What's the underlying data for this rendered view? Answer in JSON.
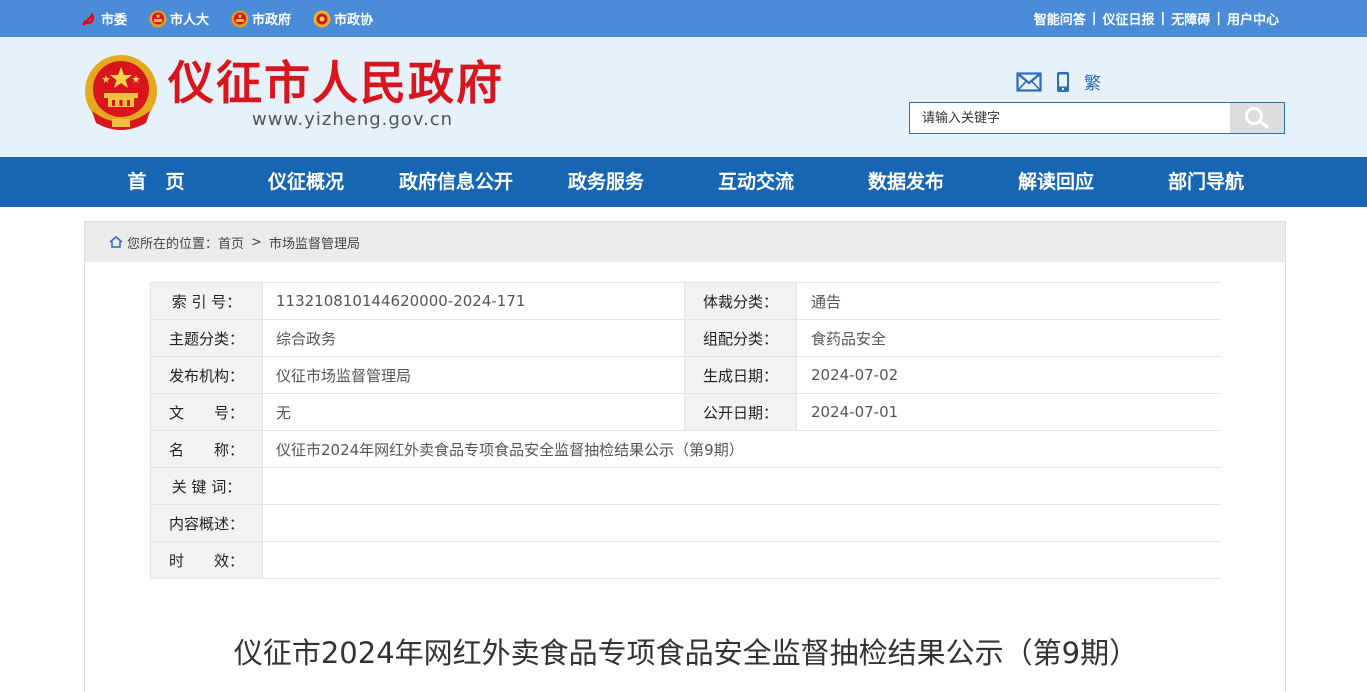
{
  "topbar": {
    "left_links": [
      {
        "label": "市委",
        "icon": "party-emblem-icon"
      },
      {
        "label": "市人大",
        "icon": "national-emblem-icon"
      },
      {
        "label": "市政府",
        "icon": "national-emblem-icon"
      },
      {
        "label": "市政协",
        "icon": "cppcc-emblem-icon"
      }
    ],
    "right_links": [
      "智能问答",
      "仪征日报",
      "无障碍",
      "用户中心"
    ],
    "separator": "|"
  },
  "header": {
    "title": "仪征市人民政府",
    "url": "www.yizheng.gov.cn",
    "traditional_label": "繁",
    "search_placeholder": "请输入关键字"
  },
  "nav": {
    "items": [
      "首　页",
      "仪征概况",
      "政府信息公开",
      "政务服务",
      "互动交流",
      "数据发布",
      "解读回应",
      "部门导航"
    ]
  },
  "breadcrumb": {
    "prefix": "您所在的位置：",
    "items": [
      "首页",
      "市场监督管理局"
    ],
    "arrow": ">"
  },
  "meta": {
    "index_label": "索 引 号：",
    "index_value": "113210810144620000-2024-171",
    "genre_label": "体裁分类：",
    "genre_value": "通告",
    "topic_label": "主题分类：",
    "topic_value": "综合政务",
    "category_label": "组配分类：",
    "category_value": "食药品安全",
    "publisher_label": "发布机构：",
    "publisher_value": "仪征市场监督管理局",
    "created_label": "生成日期：",
    "created_value": "2024-07-02",
    "docno_label": "文　　号：",
    "docno_value": "无",
    "published_label": "公开日期：",
    "published_value": "2024-07-01",
    "name_label": "名　　称：",
    "name_value": "仪征市2024年网红外卖食品专项食品安全监督抽检结果公示（第9期）",
    "keywords_label": "关 键 词：",
    "keywords_value": "",
    "summary_label": "内容概述：",
    "summary_value": "",
    "validity_label": "时　　效：",
    "validity_value": ""
  },
  "document": {
    "title": "仪征市2024年网红外卖食品专项食品安全监督抽检结果公示（第9期）"
  },
  "colors": {
    "topbar": "#4a8cd8",
    "header_bg": "#e6f1fa",
    "title_red": "#d8141c",
    "nav_blue": "#1766b2"
  }
}
